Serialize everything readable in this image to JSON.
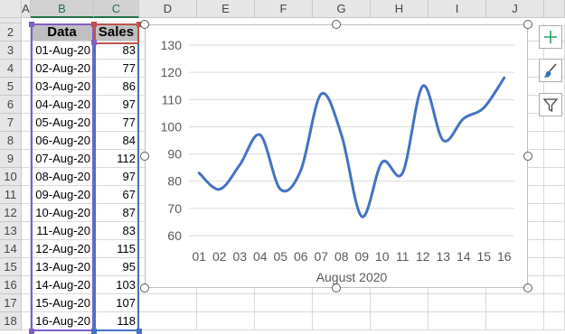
{
  "columns": [
    "A",
    "B",
    "C",
    "D",
    "E",
    "F",
    "G",
    "H",
    "I",
    "J"
  ],
  "rows": [
    "2",
    "3",
    "4",
    "5",
    "6",
    "7",
    "8",
    "9",
    "10",
    "11",
    "12",
    "13",
    "14",
    "15",
    "16",
    "17",
    "18"
  ],
  "table": {
    "header_date": "Data",
    "header_sales": "Sales",
    "dates": [
      "01-Aug-20",
      "02-Aug-20",
      "03-Aug-20",
      "04-Aug-20",
      "05-Aug-20",
      "06-Aug-20",
      "07-Aug-20",
      "08-Aug-20",
      "09-Aug-20",
      "10-Aug-20",
      "11-Aug-20",
      "12-Aug-20",
      "13-Aug-20",
      "14-Aug-20",
      "15-Aug-20",
      "16-Aug-20"
    ],
    "sales": [
      "83",
      "77",
      "86",
      "97",
      "77",
      "84",
      "112",
      "97",
      "67",
      "87",
      "83",
      "115",
      "95",
      "103",
      "107",
      "118"
    ]
  },
  "chart_data": {
    "type": "line",
    "categories": [
      "01",
      "02",
      "03",
      "04",
      "05",
      "06",
      "07",
      "08",
      "09",
      "10",
      "11",
      "12",
      "13",
      "14",
      "15",
      "16"
    ],
    "series": [
      {
        "values": [
          83,
          77,
          86,
          97,
          77,
          84,
          112,
          97,
          67,
          87,
          83,
          115,
          95,
          103,
          107,
          118
        ]
      }
    ],
    "xlabel": "August 2020",
    "ylabel": "",
    "ylim": [
      60,
      130
    ],
    "yticks": [
      "130",
      "120",
      "110",
      "100",
      "90",
      "80",
      "70",
      "60"
    ],
    "grid": true,
    "smooth": true,
    "line_color": "#4472c4"
  },
  "side_buttons": [
    {
      "icon": "plus-icon",
      "color": "#21a366"
    },
    {
      "icon": "brush-icon",
      "color": "#2e75b6"
    },
    {
      "icon": "filter-icon",
      "color": "#444444"
    }
  ]
}
